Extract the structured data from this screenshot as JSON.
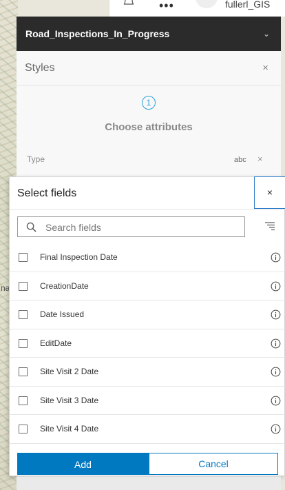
{
  "header": {
    "username": "fullerl_GIS",
    "notifications_icon": "bell-icon",
    "more_icon": "more-dots-icon",
    "more_label": "•••"
  },
  "map": {
    "partial_label": "na"
  },
  "layer": {
    "title": "Road_Inspections_In_Progress",
    "chevron": "⌄"
  },
  "styles": {
    "title": "Styles",
    "close": "×",
    "step_number": "1",
    "step_label": "Choose attributes",
    "type_label": "Type",
    "type_badge": "abc",
    "type_remove": "×"
  },
  "select_fields": {
    "title": "Select fields",
    "close": "×",
    "search_placeholder": "Search fields",
    "search_value": "",
    "fields": [
      {
        "label": "Final Inspection Date",
        "checked": false
      },
      {
        "label": "CreationDate",
        "checked": false
      },
      {
        "label": "Date Issued",
        "checked": false
      },
      {
        "label": "EditDate",
        "checked": false
      },
      {
        "label": "Site Visit 2 Date",
        "checked": false
      },
      {
        "label": "Site Visit 3 Date",
        "checked": false
      },
      {
        "label": "Site Visit 4 Date",
        "checked": false
      }
    ],
    "add_label": "Add",
    "cancel_label": "Cancel"
  },
  "colors": {
    "accent": "#0079c1",
    "header_bg": "#2b2b2b",
    "step_blue": "#2a9fd6"
  }
}
